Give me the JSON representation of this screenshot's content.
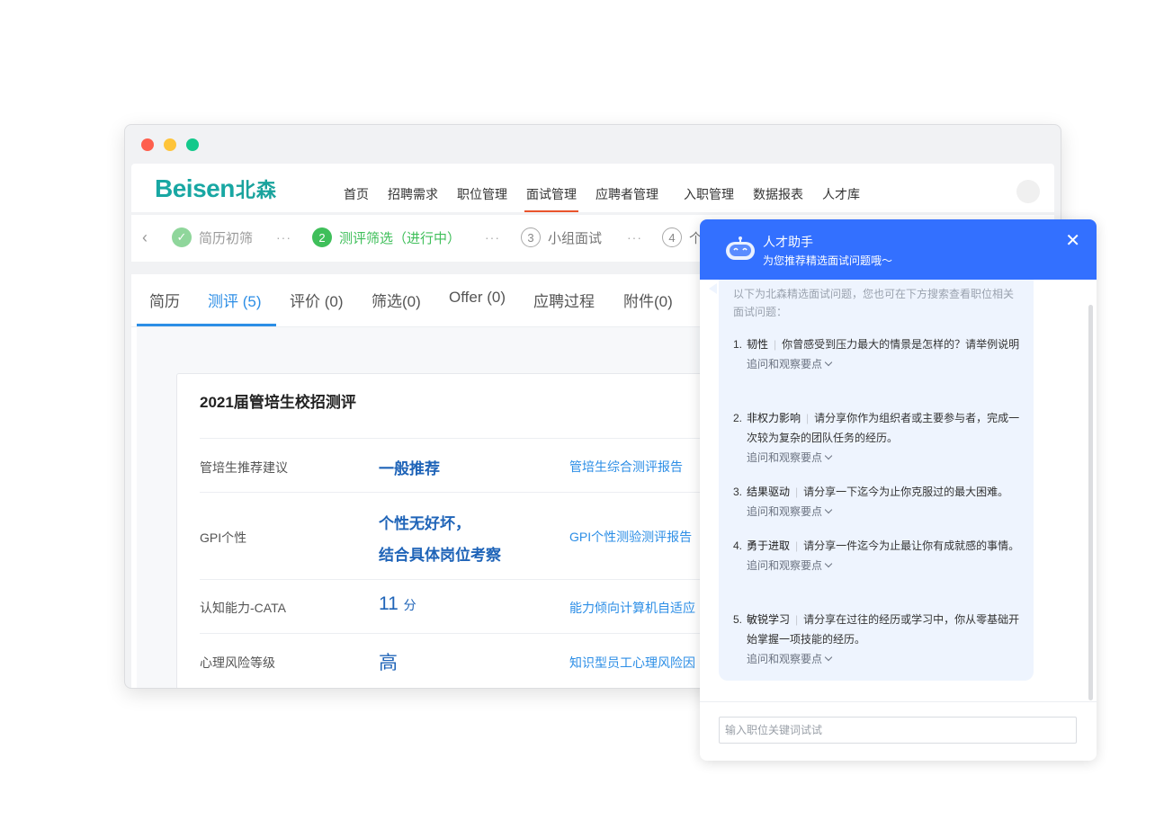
{
  "window": {
    "logo": {
      "text": "Beisen",
      "cn": "北森"
    },
    "nav": [
      "首页",
      "招聘需求",
      "职位管理",
      "面试管理",
      "应聘者管理",
      "入职管理",
      "数据报表",
      "人才库"
    ],
    "nav_active": "面试管理",
    "steps": [
      {
        "num": "✓",
        "label": "简历初筛",
        "state": "done"
      },
      {
        "num": "2",
        "label": "测评筛选（进行中）",
        "state": "current"
      },
      {
        "num": "3",
        "label": "小组面试",
        "state": "pending"
      },
      {
        "num": "4",
        "label": "个",
        "state": "pending"
      }
    ],
    "step_separator": "···",
    "tabs": [
      "简历",
      "测评 (5)",
      "评价 (0)",
      "筛选(0)",
      "Offer (0)",
      "应聘过程",
      "附件(0)"
    ],
    "card": {
      "title": "2021届管培生校招测评",
      "rows": [
        {
          "label": "管培生推荐建议",
          "value": "一般推荐",
          "link": "管培生综合测评报告"
        },
        {
          "label": "GPI个性",
          "value_line1": "个性无好坏，",
          "value_line2": "结合具体岗位考察",
          "link": "GPI个性测验测评报告"
        },
        {
          "label": "认知能力-CATA",
          "value": "11",
          "unit": "分",
          "link": "能力倾向计算机自适应"
        },
        {
          "label": "心理风险等级",
          "value": "高",
          "link": "知识型员工心理风险因"
        }
      ]
    }
  },
  "assistant": {
    "title": "人才助手",
    "subtitle": "为您推荐精选面试问题哦～",
    "close": "✕",
    "intro": "以下为北森精选面试问题，您也可在下方搜索查看职位相关面试问题：",
    "questions": [
      {
        "num": "1.",
        "tag": "韧性",
        "text": "你曾感受到压力最大的情景是怎样的？请举例说明"
      },
      {
        "num": "2.",
        "tag": "非权力影响",
        "text": "请分享你作为组织者或主要参与者，完成一次较为复杂的团队任务的经历。"
      },
      {
        "num": "3.",
        "tag": "结果驱动",
        "text": "请分享一下迄今为止你克服过的最大困难。"
      },
      {
        "num": "4.",
        "tag": "勇于进取",
        "text": "请分享一件迄今为止最让你有成就感的事情。"
      },
      {
        "num": "5.",
        "tag": "敏锐学习",
        "text": "请分享在过往的经历或学习中，你从零基础开始掌握一项技能的经历。"
      }
    ],
    "follow_label": "追问和观察要点",
    "search_placeholder": "输入职位关键词试试"
  }
}
